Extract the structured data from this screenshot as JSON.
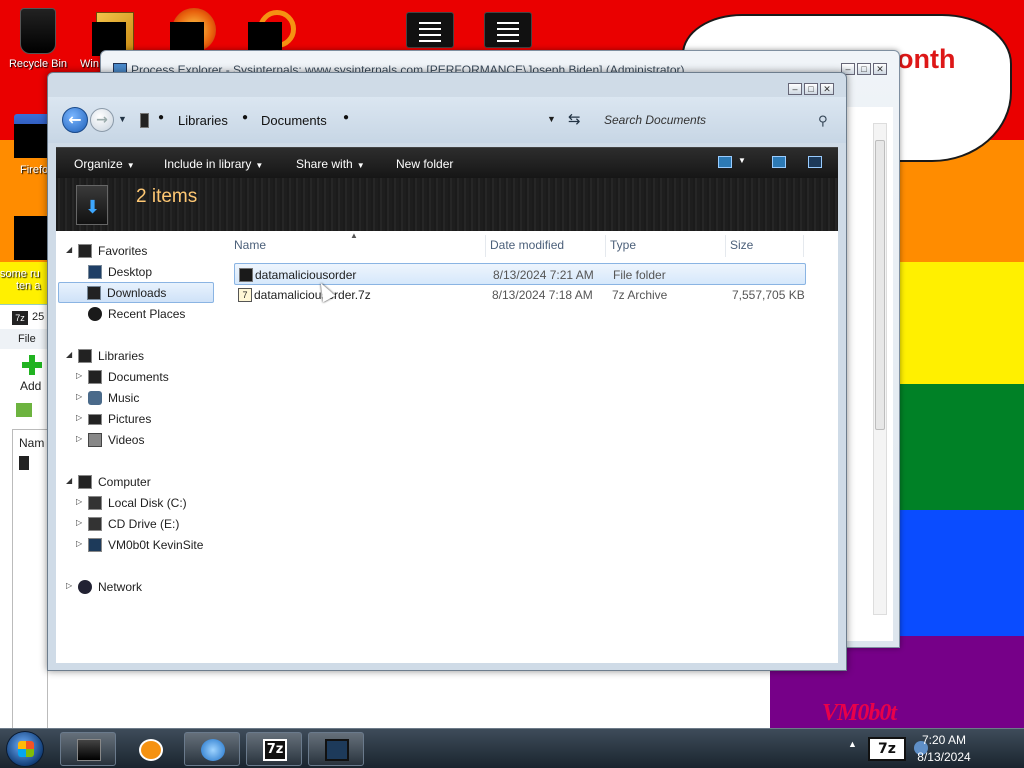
{
  "desktop": {
    "icons": [
      {
        "label": "Recycle Bin"
      },
      {
        "label": "Win"
      },
      {
        "label": "Firefo"
      },
      {
        "label": "some ru"
      },
      {
        "label": "ten a"
      }
    ],
    "bubble_text": "onth",
    "logo_text": "VM0b0t"
  },
  "bg_7zip": {
    "title_fragment": "25",
    "menu_file": "File",
    "add_label": "Add",
    "col_name": "Nam"
  },
  "procexp": {
    "title": "Process Explorer - Sysinternals: www.sysinternals.com [PERFORMANCE\\Joseph Biden] (Administrator)"
  },
  "explorer": {
    "breadcrumb": [
      "Libraries",
      "Documents"
    ],
    "search_placeholder": "Search Documents",
    "toolbar": {
      "organize": "Organize",
      "include_in_library": "Include in library",
      "share_with": "Share with",
      "new_folder": "New folder"
    },
    "item_count": "2 items",
    "nav": {
      "favorites": "Favorites",
      "desktop": "Desktop",
      "downloads": "Downloads",
      "recent_places": "Recent Places",
      "libraries": "Libraries",
      "documents": "Documents",
      "music": "Music",
      "pictures": "Pictures",
      "videos": "Videos",
      "computer": "Computer",
      "local_disk": "Local Disk (C:)",
      "cd_drive": "CD Drive (E:)",
      "vm_site": "VM0b0t KevinSite",
      "network": "Network"
    },
    "columns": {
      "name": "Name",
      "date": "Date modified",
      "type": "Type",
      "size": "Size"
    },
    "files": [
      {
        "name": "datamaliciousorder",
        "date": "8/13/2024 7:21 AM",
        "type": "File folder",
        "size": ""
      },
      {
        "name": "datamaliciousorder.7z",
        "date": "8/13/2024 7:18 AM",
        "type": "7z Archive",
        "size": "7,557,705 KB"
      }
    ]
  },
  "taskbar": {
    "time": "7:20 AM",
    "date": "8/13/2024",
    "tray_7z": "7z"
  },
  "colors": {
    "accent": "#1d5fb8",
    "toolbar_bg": "#1e1e1e",
    "item_count": "#ffc873"
  }
}
